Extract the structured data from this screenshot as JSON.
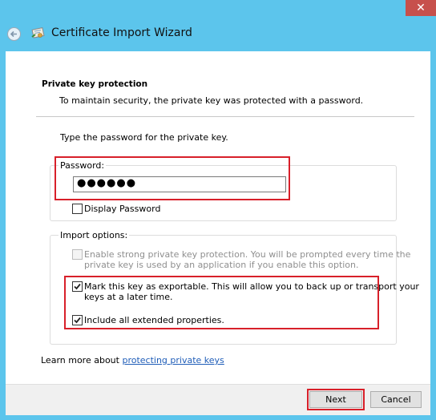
{
  "window": {
    "close_glyph": "✕",
    "title": "Certificate Import Wizard",
    "back_icon": "back-arrow-icon",
    "wizard_icon": "certificate-icon"
  },
  "page": {
    "heading": "Private key protection",
    "description": "To maintain security, the private key was protected with a password.",
    "instruction": "Type the password for the private key."
  },
  "password_group": {
    "label": "Password:",
    "value": "●●●●●●",
    "display_password_label": "Display Password",
    "display_password_checked": false
  },
  "import_options": {
    "label": "Import options:",
    "options": [
      {
        "line1": "Enable strong private key protection. You will be prompted every time the",
        "line2": "private key is used by an application if you enable this option.",
        "checked": false,
        "enabled": false
      },
      {
        "line1": "Mark this key as exportable. This will allow you to back up or transport your",
        "line2": "keys at a later time.",
        "checked": true,
        "enabled": true
      },
      {
        "line1": "Include all extended properties.",
        "checked": true,
        "enabled": true
      }
    ]
  },
  "learn_more": {
    "prefix": "Learn more about ",
    "link": "protecting private keys"
  },
  "footer": {
    "next_label": "Next",
    "cancel_label": "Cancel"
  },
  "colors": {
    "frame": "#5cc5ec",
    "highlight": "#d8202a",
    "link": "#1f5db8"
  }
}
